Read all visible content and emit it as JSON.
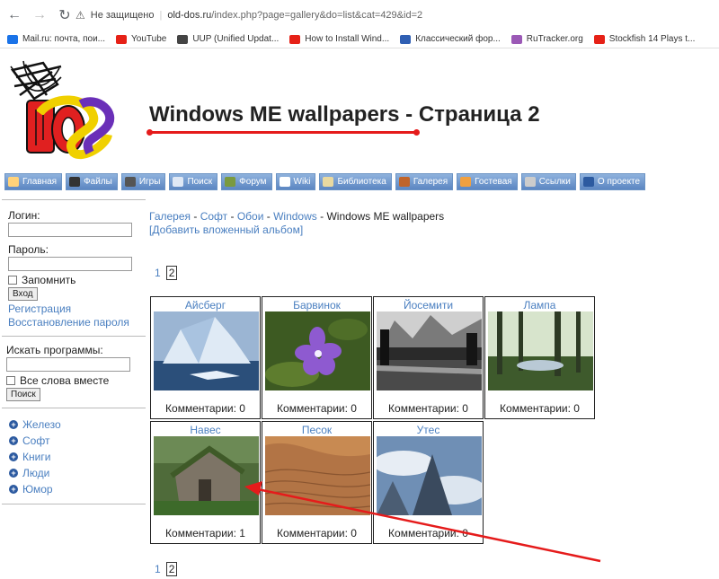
{
  "browser": {
    "security": "Не защищено",
    "url_host": "old-dos.ru",
    "url_path": "/index.php?page=gallery&do=list&cat=429&id=2",
    "bookmarks": [
      {
        "label": "Mail.ru: почта, пои...",
        "color": "#1a73e8"
      },
      {
        "label": "YouTube",
        "color": "#e62117"
      },
      {
        "label": "UUP (Unified Updat...",
        "color": "#444444"
      },
      {
        "label": "How to Install Wind...",
        "color": "#e62117"
      },
      {
        "label": "Классический фор...",
        "color": "#2f5fb3"
      },
      {
        "label": "RuTracker.org",
        "color": "#9b59b6"
      },
      {
        "label": "Stockfish 14 Plays t...",
        "color": "#e62117"
      }
    ]
  },
  "header": {
    "logo": "DOS",
    "title": "Windows ME wallpapers - Страница 2"
  },
  "nav": [
    {
      "label": "Главная",
      "icon": "home-icon"
    },
    {
      "label": "Файлы",
      "icon": "files-icon"
    },
    {
      "label": "Игры",
      "icon": "games-icon"
    },
    {
      "label": "Поиск",
      "icon": "search-icon"
    },
    {
      "label": "Форум",
      "icon": "forum-icon"
    },
    {
      "label": "Wiki",
      "icon": "wiki-icon"
    },
    {
      "label": "Библиотека",
      "icon": "library-icon"
    },
    {
      "label": "Галерея",
      "icon": "gallery-icon"
    },
    {
      "label": "Гостевая",
      "icon": "guestbook-icon"
    },
    {
      "label": "Ссылки",
      "icon": "links-icon"
    },
    {
      "label": "О проекте",
      "icon": "info-icon"
    }
  ],
  "sidebar": {
    "login_label": "Логин:",
    "password_label": "Пароль:",
    "remember_label": "Запомнить",
    "login_button": "Вход",
    "register_link": "Регистрация",
    "restore_link": "Восстановление пароля",
    "search_label": "Искать программы:",
    "all_words_label": "Все слова вместе",
    "search_button": "Поиск",
    "categories": [
      "Железо",
      "Софт",
      "Книги",
      "Люди",
      "Юмор"
    ]
  },
  "content": {
    "breadcrumb": {
      "items": [
        "Галерея",
        "Софт",
        "Обои",
        "Windows"
      ],
      "separator": " - ",
      "current": "Windows ME wallpapers"
    },
    "add_album": "[Добавить вложенный альбом]",
    "pagination": [
      "1",
      "2"
    ],
    "gallery": [
      {
        "name": "Айсберг",
        "comments": "Комментарии: 0",
        "thumb": "iceberg"
      },
      {
        "name": "Барвинок",
        "comments": "Комментарии: 0",
        "thumb": "periwinkle"
      },
      {
        "name": "Йосемити",
        "comments": "Комментарии: 0",
        "thumb": "yosemite"
      },
      {
        "name": "Лампа",
        "comments": "Комментарии: 0",
        "thumb": "forest"
      },
      {
        "name": "Навес",
        "comments": "Комментарии: 1",
        "thumb": "shed"
      },
      {
        "name": "Песок",
        "comments": "Комментарии: 0",
        "thumb": "sand"
      },
      {
        "name": "Утес",
        "comments": "Комментарии: 0",
        "thumb": "cliff"
      }
    ]
  },
  "annotation_color": "#e51b1b"
}
